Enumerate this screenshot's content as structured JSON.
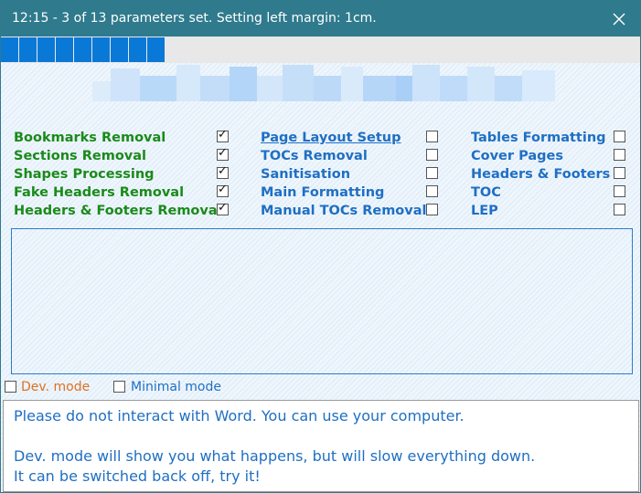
{
  "window": {
    "title": "12:15 - 3 of 13 parameters set. Setting left margin: 1cm.",
    "close_icon": "close-icon"
  },
  "progress": {
    "set": 3,
    "total": 13,
    "filled_segments": 9,
    "color": "#0a78d7"
  },
  "banner": {
    "description_icon": "blurred-logo"
  },
  "options": {
    "column1": [
      {
        "label": "Bookmarks Removal",
        "checked": true
      },
      {
        "label": "Sections Removal",
        "checked": true
      },
      {
        "label": "Shapes Processing",
        "checked": true
      },
      {
        "label": "Fake Headers Removal",
        "checked": true
      },
      {
        "label": "Headers & Footers Removal",
        "checked": true
      }
    ],
    "column2": [
      {
        "label": "Page Layout Setup",
        "checked": false,
        "active": true
      },
      {
        "label": "TOCs Removal",
        "checked": false
      },
      {
        "label": "Sanitisation",
        "checked": false
      },
      {
        "label": "Main Formatting",
        "checked": false
      },
      {
        "label": "Manual TOCs Removal",
        "checked": false
      }
    ],
    "column3": [
      {
        "label": "Tables Formatting",
        "checked": false
      },
      {
        "label": "Cover Pages",
        "checked": false
      },
      {
        "label": "Headers & Footers",
        "checked": false
      },
      {
        "label": "TOC",
        "checked": false
      },
      {
        "label": "LEP",
        "checked": false
      }
    ],
    "colors": {
      "done": "#1a8a1a",
      "pending": "#1f6fc3"
    }
  },
  "modes": {
    "dev_label": "Dev. mode",
    "dev_checked": false,
    "minimal_label": "Minimal mode",
    "minimal_checked": false
  },
  "message": {
    "line1": "Please do not interact with Word. You can use your computer.",
    "line2": "Dev. mode will show you what happens, but will slow everything down.",
    "line3": "It can be switched back off, try it!"
  }
}
